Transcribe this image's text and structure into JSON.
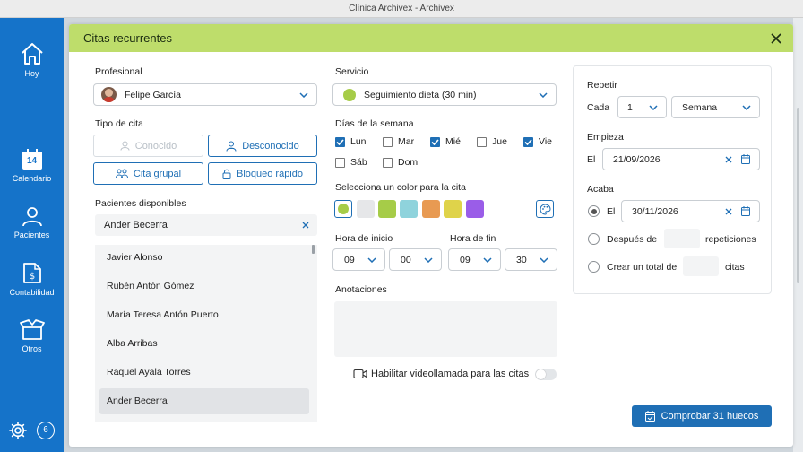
{
  "window_title": "Clínica Archivex - Archivex",
  "sidebar": {
    "items": [
      {
        "label": "Hoy",
        "icon": "home-icon"
      },
      {
        "label": "Calendario",
        "icon": "calendar-icon",
        "day": "14"
      },
      {
        "label": "Pacientes",
        "icon": "user-icon"
      },
      {
        "label": "Contabilidad",
        "icon": "invoice-icon"
      },
      {
        "label": "Otros",
        "icon": "box-icon"
      }
    ],
    "badge_count": "6"
  },
  "dialog": {
    "title": "Citas recurrentes",
    "profesional": {
      "label": "Profesional",
      "value": "Felipe García"
    },
    "tipo_cita": {
      "label": "Tipo de cita",
      "options": [
        {
          "label": "Conocido",
          "state": "disabled"
        },
        {
          "label": "Desconocido",
          "state": "enabled"
        },
        {
          "label": "Cita grupal",
          "state": "enabled"
        },
        {
          "label": "Bloqueo rápido",
          "state": "enabled"
        }
      ]
    },
    "pacientes": {
      "label": "Pacientes disponibles",
      "search_value": "Ander Becerra",
      "items": [
        "Javier Alonso",
        "Rubén Antón Gómez",
        "María Teresa Antón Puerto",
        "Alba Arribas",
        "Raquel Ayala Torres",
        "Ander Becerra"
      ],
      "selected": "Ander Becerra"
    },
    "servicio": {
      "label": "Servicio",
      "value": "Seguimiento dieta (30 min)",
      "color": "#a6cc48"
    },
    "dias": {
      "label": "Días de la semana",
      "days": [
        {
          "label": "Lun",
          "checked": true
        },
        {
          "label": "Mar",
          "checked": false
        },
        {
          "label": "Mié",
          "checked": true
        },
        {
          "label": "Jue",
          "checked": false
        },
        {
          "label": "Vie",
          "checked": true
        },
        {
          "label": "Sáb",
          "checked": false
        },
        {
          "label": "Dom",
          "checked": false
        }
      ]
    },
    "color": {
      "label": "Selecciona un color para la cita",
      "swatches": [
        "#a6cc48",
        "#e6e7e9",
        "#a6cc48",
        "#8fd3dc",
        "#e89a52",
        "#dfd34a",
        "#9a5de8"
      ],
      "selected_index": 0
    },
    "hora_inicio": {
      "label": "Hora de inicio",
      "hour": "09",
      "minute": "00"
    },
    "hora_fin": {
      "label": "Hora de fin",
      "hour": "09",
      "minute": "30"
    },
    "anotaciones": {
      "label": "Anotaciones",
      "value": ""
    },
    "videollamada": {
      "label": "Habilitar videollamada para las citas",
      "enabled": false
    },
    "repetir": {
      "label": "Repetir",
      "cada_label": "Cada",
      "cada_value": "1",
      "unit": "Semana"
    },
    "empieza": {
      "label": "Empieza",
      "prefix": "El",
      "date": "21/09/2026"
    },
    "acaba": {
      "label": "Acaba",
      "option_el": "El",
      "date": "30/11/2026",
      "option_despues": "Después de",
      "repeticiones": "repeticiones",
      "option_total": "Crear un total de",
      "citas": "citas",
      "selected": "El"
    },
    "submit_label": "Comprobar 31 huecos"
  }
}
